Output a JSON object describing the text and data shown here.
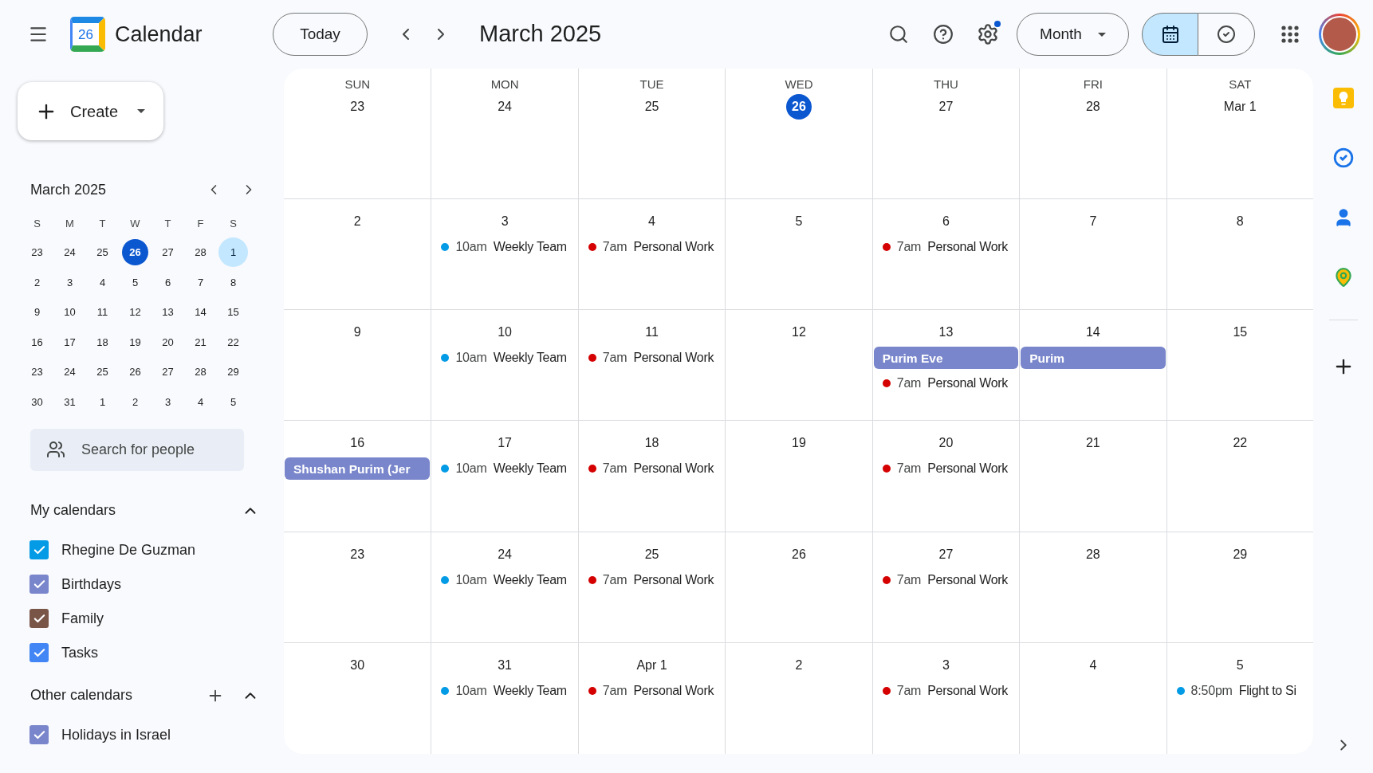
{
  "header": {
    "app_name": "Calendar",
    "logo_day": "26",
    "today_button": "Today",
    "period": "March 2025",
    "view_select": "Month",
    "settings_notice": true,
    "view_toggle": [
      {
        "kind": "calendar",
        "selected": true
      },
      {
        "kind": "tasks",
        "selected": false
      }
    ]
  },
  "sidebar": {
    "create": "Create",
    "mini_calendar": {
      "title": "March 2025",
      "weekdays": [
        "S",
        "M",
        "T",
        "W",
        "T",
        "F",
        "S"
      ],
      "days": [
        {
          "label": "23",
          "today": false,
          "selected": false
        },
        {
          "label": "24",
          "today": false,
          "selected": false
        },
        {
          "label": "25",
          "today": false,
          "selected": false
        },
        {
          "label": "26",
          "today": true,
          "selected": false
        },
        {
          "label": "27",
          "today": false,
          "selected": false
        },
        {
          "label": "28",
          "today": false,
          "selected": false
        },
        {
          "label": "1",
          "today": false,
          "selected": true
        },
        {
          "label": "2",
          "today": false,
          "selected": false
        },
        {
          "label": "3",
          "today": false,
          "selected": false
        },
        {
          "label": "4",
          "today": false,
          "selected": false
        },
        {
          "label": "5",
          "today": false,
          "selected": false
        },
        {
          "label": "6",
          "today": false,
          "selected": false
        },
        {
          "label": "7",
          "today": false,
          "selected": false
        },
        {
          "label": "8",
          "today": false,
          "selected": false
        },
        {
          "label": "9",
          "today": false,
          "selected": false
        },
        {
          "label": "10",
          "today": false,
          "selected": false
        },
        {
          "label": "11",
          "today": false,
          "selected": false
        },
        {
          "label": "12",
          "today": false,
          "selected": false
        },
        {
          "label": "13",
          "today": false,
          "selected": false
        },
        {
          "label": "14",
          "today": false,
          "selected": false
        },
        {
          "label": "15",
          "today": false,
          "selected": false
        },
        {
          "label": "16",
          "today": false,
          "selected": false
        },
        {
          "label": "17",
          "today": false,
          "selected": false
        },
        {
          "label": "18",
          "today": false,
          "selected": false
        },
        {
          "label": "19",
          "today": false,
          "selected": false
        },
        {
          "label": "20",
          "today": false,
          "selected": false
        },
        {
          "label": "21",
          "today": false,
          "selected": false
        },
        {
          "label": "22",
          "today": false,
          "selected": false
        },
        {
          "label": "23",
          "today": false,
          "selected": false
        },
        {
          "label": "24",
          "today": false,
          "selected": false
        },
        {
          "label": "25",
          "today": false,
          "selected": false
        },
        {
          "label": "26",
          "today": false,
          "selected": false
        },
        {
          "label": "27",
          "today": false,
          "selected": false
        },
        {
          "label": "28",
          "today": false,
          "selected": false
        },
        {
          "label": "29",
          "today": false,
          "selected": false
        },
        {
          "label": "30",
          "today": false,
          "selected": false
        },
        {
          "label": "31",
          "today": false,
          "selected": false
        },
        {
          "label": "1",
          "today": false,
          "selected": false
        },
        {
          "label": "2",
          "today": false,
          "selected": false
        },
        {
          "label": "3",
          "today": false,
          "selected": false
        },
        {
          "label": "4",
          "today": false,
          "selected": false
        },
        {
          "label": "5",
          "today": false,
          "selected": false
        }
      ]
    },
    "search_people": {
      "placeholder": "Search for people"
    },
    "my_calendars": {
      "title": "My calendars",
      "expanded": true,
      "items": [
        {
          "label": "Rhegine De Guzman",
          "checked": true,
          "color": "#039be5"
        },
        {
          "label": "Birthdays",
          "checked": true,
          "color": "#7986cb"
        },
        {
          "label": "Family",
          "checked": true,
          "color": "#795548"
        },
        {
          "label": "Tasks",
          "checked": true,
          "color": "#4285f4"
        }
      ]
    },
    "other_calendars": {
      "title": "Other calendars",
      "expanded": true,
      "items": [
        {
          "label": "Holidays in Israel",
          "checked": true,
          "color": "#7986cb"
        }
      ]
    }
  },
  "grid": {
    "weekdays": [
      "SUN",
      "MON",
      "TUE",
      "WED",
      "THU",
      "FRI",
      "SAT"
    ],
    "days": [
      {
        "date": "23",
        "today": false
      },
      {
        "date": "24",
        "today": false
      },
      {
        "date": "25",
        "today": false
      },
      {
        "date": "26",
        "today": true
      },
      {
        "date": "27",
        "today": false
      },
      {
        "date": "28",
        "today": false
      },
      {
        "date": "Mar 1",
        "today": false
      },
      {
        "date": "2",
        "today": false
      },
      {
        "date": "3",
        "today": false,
        "events": [
          {
            "kind": "timed",
            "time": "10am",
            "title": "Weekly Team",
            "color": "#039be5"
          }
        ]
      },
      {
        "date": "4",
        "today": false,
        "events": [
          {
            "kind": "timed",
            "time": "7am",
            "title": "Personal Work",
            "color": "#d50000"
          }
        ]
      },
      {
        "date": "5",
        "today": false
      },
      {
        "date": "6",
        "today": false,
        "events": [
          {
            "kind": "timed",
            "time": "7am",
            "title": "Personal Work",
            "color": "#d50000"
          }
        ]
      },
      {
        "date": "7",
        "today": false
      },
      {
        "date": "8",
        "today": false
      },
      {
        "date": "9",
        "today": false
      },
      {
        "date": "10",
        "today": false,
        "events": [
          {
            "kind": "timed",
            "time": "10am",
            "title": "Weekly Team",
            "color": "#039be5"
          }
        ]
      },
      {
        "date": "11",
        "today": false,
        "events": [
          {
            "kind": "timed",
            "time": "7am",
            "title": "Personal Work",
            "color": "#d50000"
          }
        ]
      },
      {
        "date": "12",
        "today": false
      },
      {
        "date": "13",
        "today": false,
        "events": [
          {
            "kind": "allday",
            "title": "Purim Eve",
            "color": "#7986cb"
          },
          {
            "kind": "timed",
            "time": "7am",
            "title": "Personal Work",
            "color": "#d50000"
          }
        ]
      },
      {
        "date": "14",
        "today": false,
        "events": [
          {
            "kind": "allday",
            "title": "Purim",
            "color": "#7986cb"
          }
        ]
      },
      {
        "date": "15",
        "today": false
      },
      {
        "date": "16",
        "today": false,
        "events": [
          {
            "kind": "allday",
            "title": "Shushan Purim (Jer",
            "color": "#7986cb"
          }
        ]
      },
      {
        "date": "17",
        "today": false,
        "events": [
          {
            "kind": "timed",
            "time": "10am",
            "title": "Weekly Team",
            "color": "#039be5"
          }
        ]
      },
      {
        "date": "18",
        "today": false,
        "events": [
          {
            "kind": "timed",
            "time": "7am",
            "title": "Personal Work",
            "color": "#d50000"
          }
        ]
      },
      {
        "date": "19",
        "today": false
      },
      {
        "date": "20",
        "today": false,
        "events": [
          {
            "kind": "timed",
            "time": "7am",
            "title": "Personal Work",
            "color": "#d50000"
          }
        ]
      },
      {
        "date": "21",
        "today": false
      },
      {
        "date": "22",
        "today": false
      },
      {
        "date": "23",
        "today": false
      },
      {
        "date": "24",
        "today": false,
        "events": [
          {
            "kind": "timed",
            "time": "10am",
            "title": "Weekly Team",
            "color": "#039be5"
          }
        ]
      },
      {
        "date": "25",
        "today": false,
        "events": [
          {
            "kind": "timed",
            "time": "7am",
            "title": "Personal Work",
            "color": "#d50000"
          }
        ]
      },
      {
        "date": "26",
        "today": false
      },
      {
        "date": "27",
        "today": false,
        "events": [
          {
            "kind": "timed",
            "time": "7am",
            "title": "Personal Work",
            "color": "#d50000"
          }
        ]
      },
      {
        "date": "28",
        "today": false
      },
      {
        "date": "29",
        "today": false
      },
      {
        "date": "30",
        "today": false
      },
      {
        "date": "31",
        "today": false,
        "events": [
          {
            "kind": "timed",
            "time": "10am",
            "title": "Weekly Team",
            "color": "#039be5"
          }
        ]
      },
      {
        "date": "Apr 1",
        "today": false,
        "events": [
          {
            "kind": "timed",
            "time": "7am",
            "title": "Personal Work",
            "color": "#d50000"
          }
        ]
      },
      {
        "date": "2",
        "today": false
      },
      {
        "date": "3",
        "today": false,
        "events": [
          {
            "kind": "timed",
            "time": "7am",
            "title": "Personal Work",
            "color": "#d50000"
          }
        ]
      },
      {
        "date": "4",
        "today": false
      },
      {
        "date": "5",
        "today": false,
        "events": [
          {
            "kind": "timed",
            "time": "8:50pm",
            "title": "Flight to Si",
            "color": "#039be5"
          }
        ]
      }
    ]
  }
}
